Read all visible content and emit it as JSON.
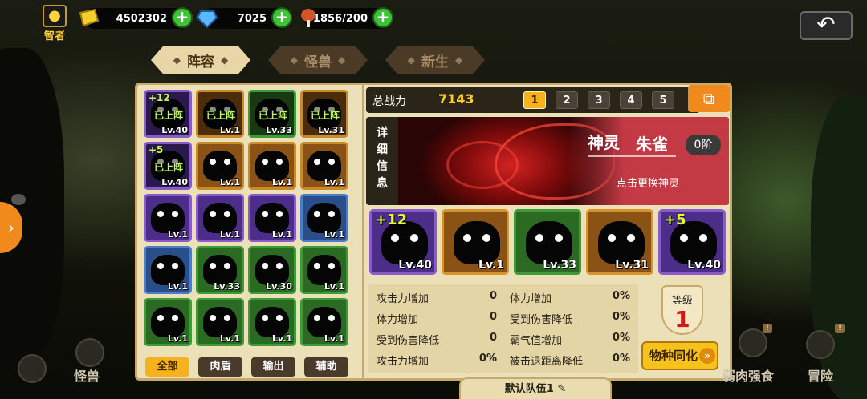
{
  "top": {
    "title_badge": "智者",
    "gold": "4502302",
    "gems": "7025",
    "meat": "1856/200"
  },
  "tabs": [
    {
      "label": "阵容",
      "active": true
    },
    {
      "label": "怪兽",
      "active": false
    },
    {
      "label": "新生",
      "active": false
    }
  ],
  "roster": [
    {
      "frame": "purple",
      "level": "Lv.40",
      "deployed": "已上阵",
      "plus": "+12"
    },
    {
      "frame": "orange",
      "level": "Lv.1",
      "deployed": "已上阵",
      "plus": ""
    },
    {
      "frame": "green",
      "level": "Lv.33",
      "deployed": "已上阵",
      "plus": ""
    },
    {
      "frame": "orange",
      "level": "Lv.31",
      "deployed": "已上阵",
      "plus": ""
    },
    {
      "frame": "purple",
      "level": "Lv.40",
      "deployed": "已上阵",
      "plus": "+5"
    },
    {
      "frame": "orange",
      "level": "Lv.1",
      "deployed": "",
      "plus": ""
    },
    {
      "frame": "orange",
      "level": "Lv.1",
      "deployed": "",
      "plus": ""
    },
    {
      "frame": "orange",
      "level": "Lv.1",
      "deployed": "",
      "plus": ""
    },
    {
      "frame": "purple",
      "level": "Lv.1",
      "deployed": "",
      "plus": ""
    },
    {
      "frame": "purple",
      "level": "Lv.1",
      "deployed": "",
      "plus": ""
    },
    {
      "frame": "purple",
      "level": "Lv.1",
      "deployed": "",
      "plus": ""
    },
    {
      "frame": "blue",
      "level": "Lv.1",
      "deployed": "",
      "plus": ""
    },
    {
      "frame": "blue",
      "level": "Lv.1",
      "deployed": "",
      "plus": ""
    },
    {
      "frame": "green",
      "level": "Lv.33",
      "deployed": "",
      "plus": ""
    },
    {
      "frame": "green",
      "level": "Lv.30",
      "deployed": "",
      "plus": ""
    },
    {
      "frame": "green",
      "level": "Lv.1",
      "deployed": "",
      "plus": ""
    },
    {
      "frame": "green",
      "level": "Lv.1",
      "deployed": "",
      "plus": ""
    },
    {
      "frame": "green",
      "level": "Lv.1",
      "deployed": "",
      "plus": ""
    },
    {
      "frame": "green",
      "level": "Lv.1",
      "deployed": "",
      "plus": ""
    },
    {
      "frame": "green",
      "level": "Lv.1",
      "deployed": "",
      "plus": ""
    }
  ],
  "filters": [
    "全部",
    "肉盾",
    "输出",
    "辅助"
  ],
  "power": {
    "label": "总战力",
    "value": "7143"
  },
  "team_slots": [
    "1",
    "2",
    "3",
    "4",
    "5"
  ],
  "detail": {
    "side_label": "详细信息",
    "god_type": "神灵",
    "god_name": "朱雀",
    "rank": "0阶",
    "hint": "点击更换神灵"
  },
  "team": [
    {
      "frame": "purple",
      "level": "Lv.40",
      "plus": "+12"
    },
    {
      "frame": "orange",
      "level": "Lv.1",
      "plus": ""
    },
    {
      "frame": "green",
      "level": "Lv.33",
      "plus": ""
    },
    {
      "frame": "orange",
      "level": "Lv.31",
      "plus": ""
    },
    {
      "frame": "purple",
      "level": "Lv.40",
      "plus": "+5"
    }
  ],
  "stats": [
    {
      "label": "攻击力增加",
      "value": "0"
    },
    {
      "label": "体力增加",
      "value": "0"
    },
    {
      "label": "受到伤害降低",
      "value": "0"
    },
    {
      "label": "攻击力增加",
      "value": "0%"
    },
    {
      "label": "体力增加",
      "value": "0%"
    },
    {
      "label": "受到伤害降低",
      "value": "0%"
    },
    {
      "label": "霸气值增加",
      "value": "0%"
    },
    {
      "label": "被击退距离降低",
      "value": "0%"
    }
  ],
  "level": {
    "label": "等级",
    "value": "1"
  },
  "sync_button": "物种同化",
  "default_team": "默认队伍1",
  "bottom_nav": [
    "怪兽",
    "弱肉强食",
    "冒险"
  ]
}
